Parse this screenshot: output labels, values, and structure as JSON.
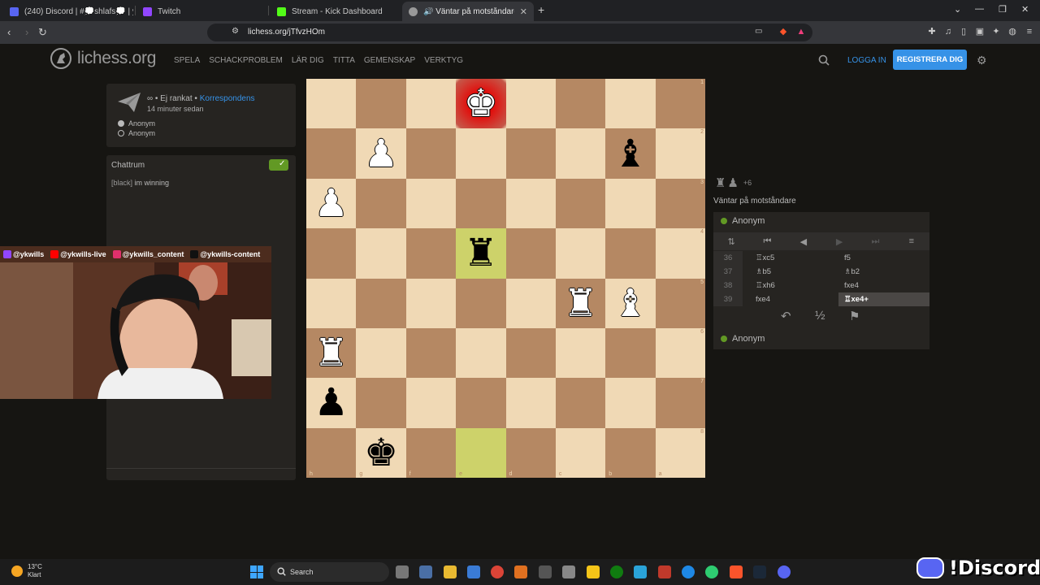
{
  "browser": {
    "tabs": [
      {
        "title": "(240) Discord | #💭shlafs💭 | ykwills",
        "fav_color": "#5865f2",
        "active": false
      },
      {
        "title": "Twitch",
        "fav_color": "#9146ff",
        "active": false
      },
      {
        "title": "Stream - Kick Dashboard",
        "fav_color": "#53fc18",
        "active": false
      },
      {
        "title": "🔊 Väntar på motståndare - Spel",
        "fav_color": "#bababa",
        "active": true
      }
    ],
    "url": "lichess.org/jTfvzHOm"
  },
  "header": {
    "logo": "lichess.org",
    "nav": [
      "SPELA",
      "SCHACKPROBLEM",
      "LÄR DIG",
      "TITTA",
      "GEMENSKAP",
      "VERKTYG"
    ],
    "login": "LOGGA IN",
    "register": "REGISTRERA DIG"
  },
  "game_info": {
    "type_prefix": "∞ • Ej rankat •",
    "type_link": "Korrespondens",
    "time_ago": "14 minuter sedan",
    "players": [
      "Anonym",
      "Anonym"
    ]
  },
  "chat": {
    "title": "Chattrum",
    "messages": [
      {
        "user": "[black]",
        "text": "im winning"
      }
    ]
  },
  "stream": {
    "socials": [
      "@ykwills",
      "@ykwills-live",
      "@ykwills_content",
      "@ykwills-content"
    ],
    "colors": {
      "twitch": "#9146ff",
      "youtube": "#ff0000",
      "instagram": "#e1306c",
      "tiktok": "#111111"
    }
  },
  "board": {
    "orientation": "black",
    "ranks": [
      "1",
      "2",
      "3",
      "4",
      "5",
      "6",
      "7",
      "8"
    ],
    "files": [
      "h",
      "g",
      "f",
      "e",
      "d",
      "c",
      "b",
      "a"
    ],
    "rows": [
      [
        "",
        "",
        "",
        "wk",
        "",
        "",
        "",
        ""
      ],
      [
        "",
        "wp",
        "",
        "",
        "",
        "",
        "bb",
        ""
      ],
      [
        "wp",
        "",
        "",
        "",
        "",
        "",
        "",
        ""
      ],
      [
        "",
        "",
        "",
        "br",
        "",
        "",
        "",
        ""
      ],
      [
        "",
        "",
        "",
        "",
        "",
        "wr",
        "wb",
        ""
      ],
      [
        "wr",
        "",
        "",
        "",
        "",
        "",
        "",
        ""
      ],
      [
        "bp",
        "",
        "",
        "",
        "",
        "",
        "",
        ""
      ],
      [
        "",
        "bk",
        "",
        "",
        "",
        "",
        "",
        ""
      ]
    ],
    "highlights": [
      "3-3",
      "7-3"
    ],
    "check": "0-3"
  },
  "right_panel": {
    "material": {
      "pieces": [
        "♜",
        "♟"
      ],
      "diff": "+6"
    },
    "status": "Väntar på motståndare",
    "top_player": "Anonym",
    "bottom_player": "Anonym",
    "moves": [
      {
        "num": "36",
        "white": "♖xc5",
        "black": "f5"
      },
      {
        "num": "37",
        "white": "♗b5",
        "black": "♗b2"
      },
      {
        "num": "38",
        "white": "♖xh6",
        "black": "fxe4"
      },
      {
        "num": "39",
        "white": "fxe4",
        "black": "♖xe4+"
      }
    ],
    "draw_symbol": "½"
  },
  "taskbar": {
    "weather_temp": "13°C",
    "weather_desc": "Klart",
    "search": "Search"
  },
  "watermark": "!Discord"
}
